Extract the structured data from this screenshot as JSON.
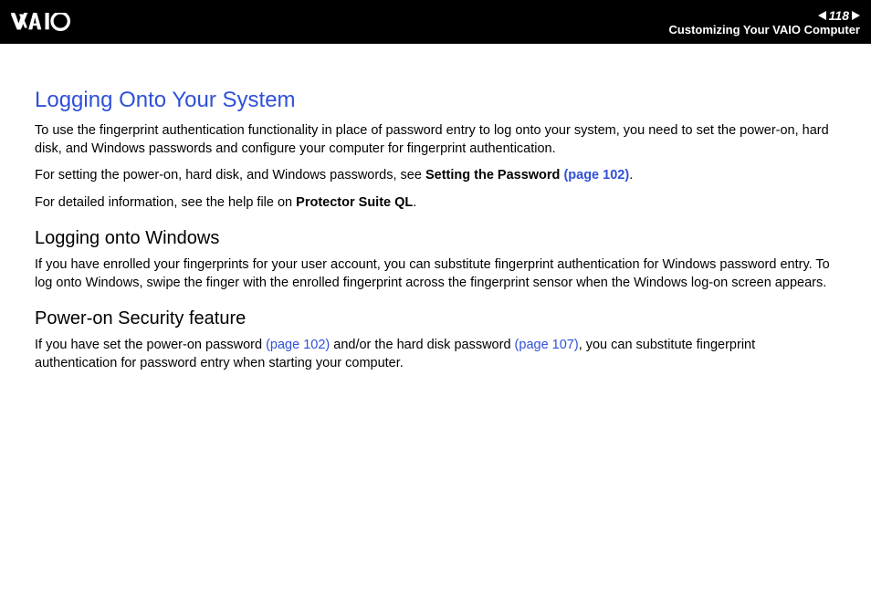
{
  "header": {
    "page_number": "118",
    "section": "Customizing Your VAIO Computer"
  },
  "content": {
    "heading": "Logging Onto Your System",
    "p1": "To use the fingerprint authentication functionality in place of password entry to log onto your system, you need to set the power-on, hard disk, and Windows passwords and configure your computer for fingerprint authentication.",
    "p2_a": "For setting the power-on, hard disk, and Windows passwords, see ",
    "p2_bold": "Setting the Password ",
    "p2_link": "(page 102)",
    "p2_b": ".",
    "p3_a": "For detailed information, see the help file on ",
    "p3_bold": "Protector Suite QL",
    "p3_b": ".",
    "sub1": "Logging onto Windows",
    "p4": "If you have enrolled your fingerprints for your user account, you can substitute fingerprint authentication for Windows password entry. To log onto Windows, swipe the finger with the enrolled fingerprint across the fingerprint sensor when the Windows log-on screen appears.",
    "sub2": "Power-on Security feature",
    "p5_a": "If you have set the power-on password ",
    "p5_link1": "(page 102)",
    "p5_b": " and/or the hard disk password ",
    "p5_link2": "(page 107)",
    "p5_c": ", you can substitute fingerprint authentication for password entry when starting your computer."
  }
}
